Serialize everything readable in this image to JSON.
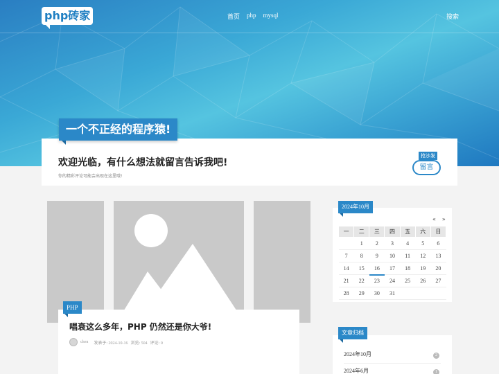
{
  "header": {
    "logo": "php砖家",
    "nav": [
      "首页",
      "php",
      "mysql"
    ],
    "search": "搜索"
  },
  "hero": {
    "slogan": "一个不正经的程序猿!"
  },
  "welcome": {
    "title": "欢迎光临，有什么想法就留言告诉我吧!",
    "subtitle": "你的精彩评论可能会出现在这里哦!",
    "message_tag": "抢沙发",
    "message_button": "留言"
  },
  "post": {
    "category": "PHP",
    "title": "唱衰这么多年，PHP 仍然还是你大爷!",
    "author": "chen",
    "published": "发表于: 2024-10-16",
    "views": "浏览: 504",
    "comments": "评论: 0"
  },
  "calendar": {
    "title": "2024年10月",
    "prev": "«",
    "next": "»",
    "weekdays": [
      "一",
      "二",
      "三",
      "四",
      "五",
      "六",
      "日"
    ],
    "weeks": [
      [
        "",
        "1",
        "2",
        "3",
        "4",
        "5",
        "6"
      ],
      [
        "7",
        "8",
        "9",
        "10",
        "11",
        "12",
        "13"
      ],
      [
        "14",
        "15",
        "16",
        "17",
        "18",
        "19",
        "20"
      ],
      [
        "21",
        "22",
        "23",
        "24",
        "25",
        "26",
        "27"
      ],
      [
        "28",
        "29",
        "30",
        "31",
        "",
        "",
        ""
      ]
    ],
    "today": "16"
  },
  "archive": {
    "title": "文章归档",
    "items": [
      {
        "label": "2024年10月",
        "count": "2"
      },
      {
        "label": "2024年6月",
        "count": "1"
      }
    ]
  },
  "colors": {
    "accent": "#2b88c8",
    "hero_light": "#55c4e0",
    "hero_dark": "#1f78c0"
  }
}
